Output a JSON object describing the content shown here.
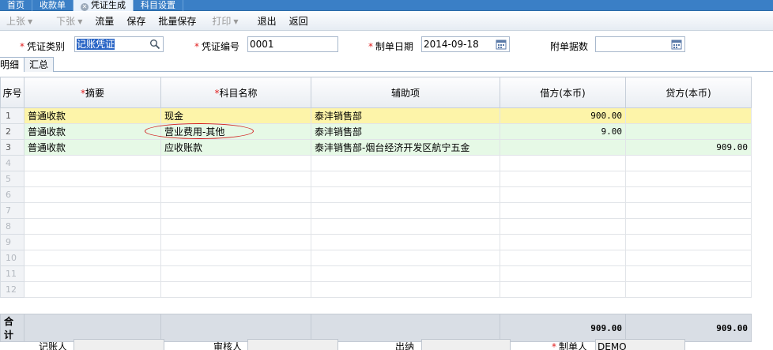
{
  "tabs": [
    {
      "label": "首页",
      "active": false
    },
    {
      "label": "收款单",
      "active": false
    },
    {
      "label": "凭证生成",
      "active": true
    },
    {
      "label": "科目设置",
      "active": false
    }
  ],
  "toolbar": {
    "prev": "上张",
    "next": "下张",
    "flow": "流量",
    "save": "保存",
    "batch_save": "批量保存",
    "print": "打印",
    "exit": "退出",
    "back": "返回"
  },
  "form": {
    "voucher_type_label": "凭证类别",
    "voucher_type_value": "记账凭证",
    "voucher_no_label": "凭证编号",
    "voucher_no_value": "0001",
    "date_label": "制单日期",
    "date_value": "2014-09-18",
    "attach_label": "附单据数",
    "attach_value": ""
  },
  "subtabs": {
    "detail": "明细",
    "summary": "汇总"
  },
  "grid": {
    "headers": {
      "rownum": "序号",
      "summary": "摘要",
      "subject": "科目名称",
      "aux": "辅助项",
      "debit": "借方(本币)",
      "credit": "贷方(本币)"
    },
    "rows": [
      {
        "n": "1",
        "summary": "普通收款",
        "subject": "现金",
        "aux": "泰沣销售部",
        "debit": "900.00",
        "credit": ""
      },
      {
        "n": "2",
        "summary": "普通收款",
        "subject": "营业费用-其他",
        "aux": "泰沣销售部",
        "debit": "9.00",
        "credit": ""
      },
      {
        "n": "3",
        "summary": "普通收款",
        "subject": "应收账款",
        "aux": "泰沣销售部-烟台经济开发区航宁五金",
        "debit": "",
        "credit": "909.00"
      },
      {
        "n": "4",
        "summary": "",
        "subject": "",
        "aux": "",
        "debit": "",
        "credit": ""
      },
      {
        "n": "5",
        "summary": "",
        "subject": "",
        "aux": "",
        "debit": "",
        "credit": ""
      },
      {
        "n": "6",
        "summary": "",
        "subject": "",
        "aux": "",
        "debit": "",
        "credit": ""
      },
      {
        "n": "7",
        "summary": "",
        "subject": "",
        "aux": "",
        "debit": "",
        "credit": ""
      },
      {
        "n": "8",
        "summary": "",
        "subject": "",
        "aux": "",
        "debit": "",
        "credit": ""
      },
      {
        "n": "9",
        "summary": "",
        "subject": "",
        "aux": "",
        "debit": "",
        "credit": ""
      },
      {
        "n": "10",
        "summary": "",
        "subject": "",
        "aux": "",
        "debit": "",
        "credit": ""
      },
      {
        "n": "11",
        "summary": "",
        "subject": "",
        "aux": "",
        "debit": "",
        "credit": ""
      },
      {
        "n": "12",
        "summary": "",
        "subject": "",
        "aux": "",
        "debit": "",
        "credit": ""
      }
    ]
  },
  "total": {
    "label": "合计",
    "debit": "909.00",
    "credit": "909.00"
  },
  "signers": {
    "bookkeeper_label": "记账人",
    "bookkeeper_value": "",
    "auditor_label": "审核人",
    "auditor_value": "",
    "cashier_label": "出纳",
    "cashier_value": "",
    "maker_label": "制单人",
    "maker_value": "DEMO"
  }
}
